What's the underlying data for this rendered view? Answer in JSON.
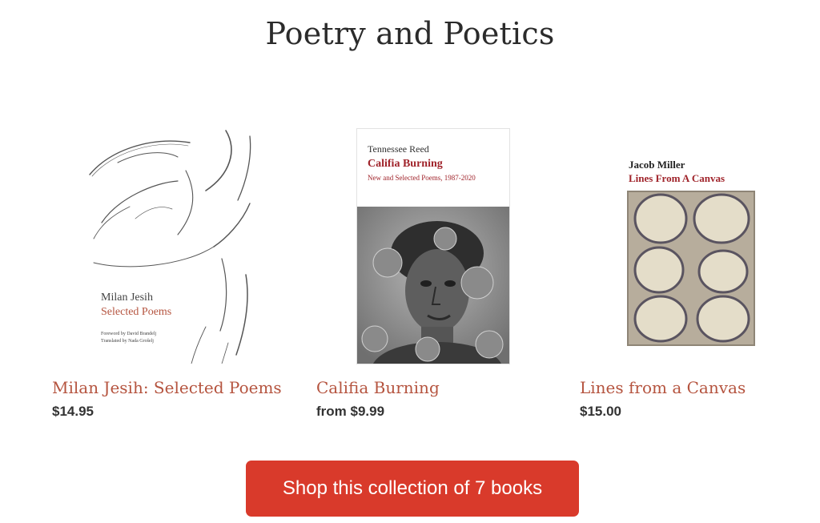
{
  "section": {
    "title": "Poetry and Poetics"
  },
  "books": [
    {
      "title": "Milan Jesih: Selected Poems",
      "price": "$14.95",
      "cover": {
        "author": "Milan Jesih",
        "subtitle": "Selected Poems",
        "credit_1": "Foreword by David Brandelj",
        "credit_2": "Translated by Nada Grošelj"
      }
    },
    {
      "title": "Califia Burning",
      "price": "from $9.99",
      "cover": {
        "author": "Tennessee Reed",
        "title": "Califia Burning",
        "subtitle": "New and Selected Poems, 1987-2020"
      }
    },
    {
      "title": "Lines from a Canvas",
      "price": "$15.00",
      "cover": {
        "author": "Jacob Miller",
        "title": "Lines From A Canvas"
      }
    }
  ],
  "cta": {
    "label": "Shop this collection of 7 books"
  },
  "colors": {
    "title_link": "#b5543f",
    "button_bg": "#d93a2b",
    "cover_accent": "#a0242b"
  }
}
